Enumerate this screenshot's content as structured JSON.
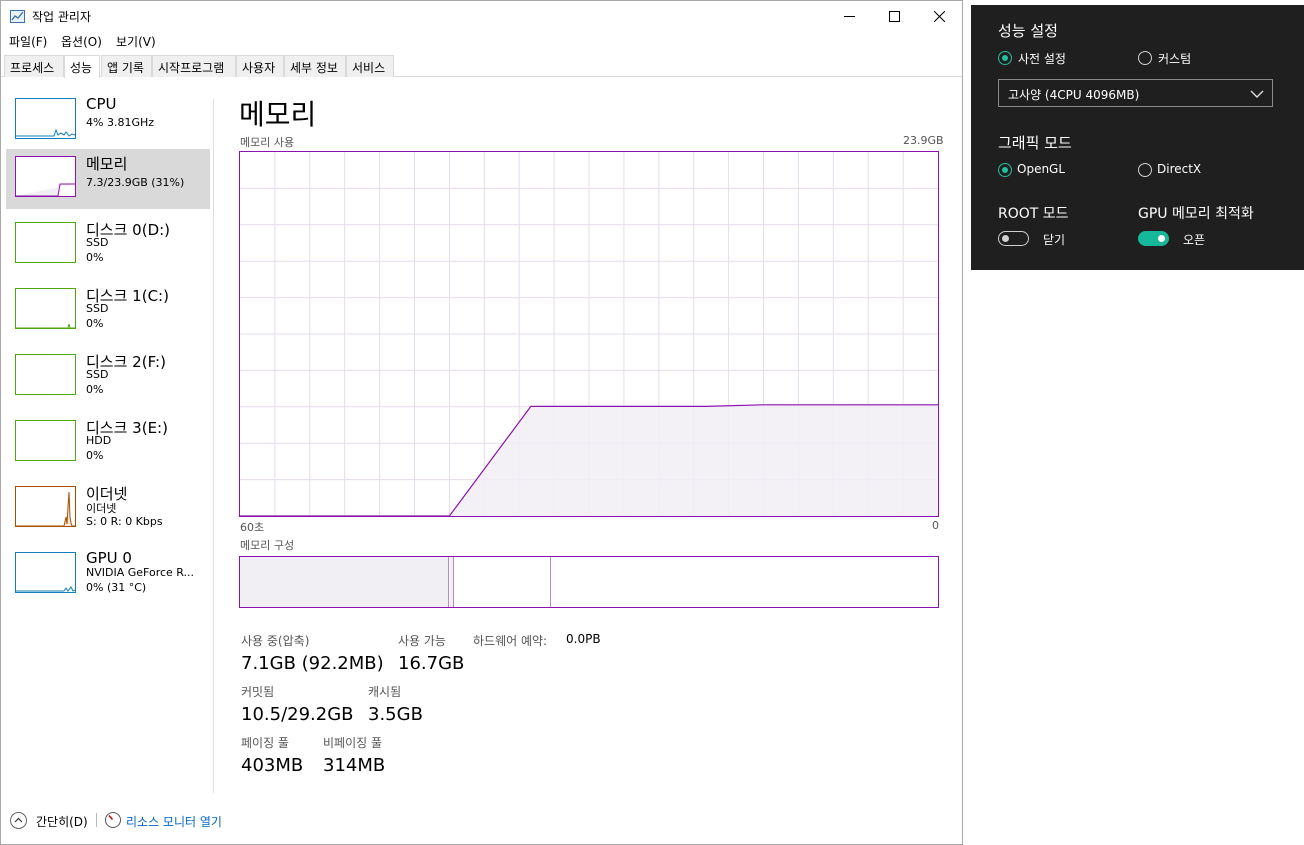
{
  "window": {
    "title": "작업 관리자",
    "menu": [
      "파일(F)",
      "옵션(O)",
      "보기(V)"
    ],
    "tabs": [
      "프로세스",
      "성능",
      "앱 기록",
      "시작프로그램",
      "사용자",
      "세부 정보",
      "서비스"
    ],
    "active_tab": "성능"
  },
  "sidebar": {
    "items": [
      {
        "name": "CPU",
        "line1": "4% 3.81GHz",
        "line2": "",
        "color": "#117dbb",
        "selected": false
      },
      {
        "name": "메모리",
        "line1": "7.3/23.9GB (31%)",
        "line2": "",
        "color": "#8b12ae",
        "selected": true
      },
      {
        "name": "디스크 0(D:)",
        "line1": "SSD",
        "line2": "0%",
        "color": "#4da60c",
        "selected": false
      },
      {
        "name": "디스크 1(C:)",
        "line1": "SSD",
        "line2": "0%",
        "color": "#4da60c",
        "selected": false
      },
      {
        "name": "디스크 2(F:)",
        "line1": "SSD",
        "line2": "0%",
        "color": "#4da60c",
        "selected": false
      },
      {
        "name": "디스크 3(E:)",
        "line1": "HDD",
        "line2": "0%",
        "color": "#4da60c",
        "selected": false
      },
      {
        "name": "이더넷",
        "line1": "이더넷",
        "line2": "S: 0 R: 0 Kbps",
        "color": "#a74f01",
        "selected": false
      },
      {
        "name": "GPU 0",
        "line1": "NVIDIA GeForce R...",
        "line2": "0% (31 °C)",
        "color": "#117dbb",
        "selected": false
      }
    ]
  },
  "main": {
    "title": "메모리",
    "graph_label": "메모리 사용",
    "graph_max": "23.9GB",
    "time_left": "60초",
    "time_right": "0",
    "composition_label": "메모리 구성",
    "stats": {
      "in_use_label": "사용 중(압축)",
      "in_use_value": "7.1GB (92.2MB)",
      "available_label": "사용 가능",
      "available_value": "16.7GB",
      "hw_reserved_label": "하드웨어 예약:",
      "hw_reserved_value": "0.0PB",
      "committed_label": "커밋됨",
      "committed_value": "10.5/29.2GB",
      "cached_label": "캐시됨",
      "cached_value": "3.5GB",
      "paged_label": "페이징 풀",
      "paged_value": "403MB",
      "nonpaged_label": "비페이징 풀",
      "nonpaged_value": "314MB"
    }
  },
  "footer": {
    "collapse_label": "간단히(D)",
    "resource_monitor_label": "리소스 모니터 열기"
  },
  "panel": {
    "performance_heading": "성능 설정",
    "preset_label": "사전 설정",
    "custom_label": "커스텀",
    "preset_selected": true,
    "preset_value": "고사양 (4CPU 4096MB)",
    "graphics_heading": "그래픽 모드",
    "opengl_label": "OpenGL",
    "directx_label": "DirectX",
    "opengl_selected": true,
    "root_heading": "ROOT 모드",
    "root_state": "닫기",
    "root_on": false,
    "gpu_heading": "GPU 메모리 최적화",
    "gpu_state": "오픈",
    "gpu_on": true,
    "accent": "#17b89a"
  },
  "chart_data": {
    "type": "area",
    "title": "메모리 사용",
    "xlabel": "",
    "ylabel": "",
    "x": [
      60,
      57,
      50,
      44,
      42,
      35,
      30,
      28,
      25,
      20,
      15,
      10,
      5,
      0
    ],
    "values": [
      0,
      0,
      0,
      0,
      0,
      7.2,
      7.2,
      7.2,
      7.2,
      7.2,
      7.3,
      7.3,
      7.3,
      7.3
    ],
    "ylim": [
      0,
      23.9
    ],
    "grid": true
  }
}
